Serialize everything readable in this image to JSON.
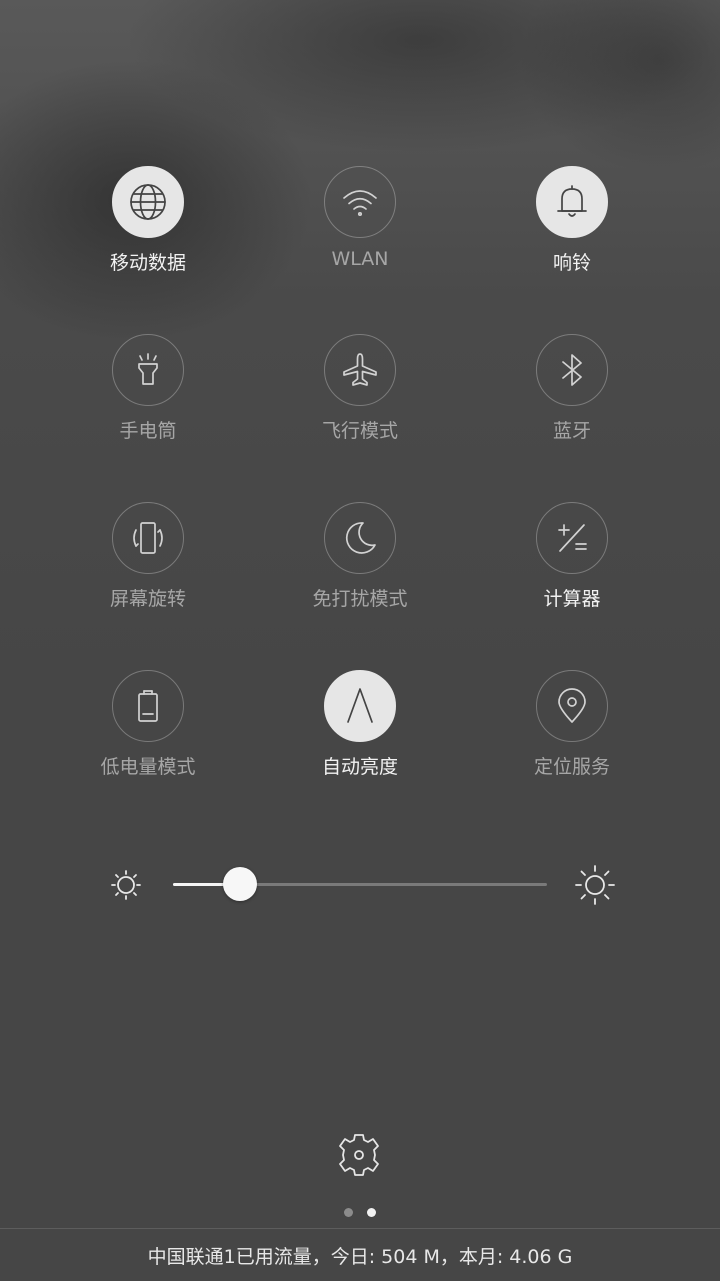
{
  "tiles": [
    {
      "label": "移动数据",
      "icon": "globe-icon",
      "state": "on"
    },
    {
      "label": "WLAN",
      "icon": "wifi-icon",
      "state": "off"
    },
    {
      "label": "响铃",
      "icon": "bell-icon",
      "state": "on"
    },
    {
      "label": "手电筒",
      "icon": "flashlight-icon",
      "state": "off"
    },
    {
      "label": "飞行模式",
      "icon": "airplane-icon",
      "state": "off"
    },
    {
      "label": "蓝牙",
      "icon": "bluetooth-icon",
      "state": "off"
    },
    {
      "label": "屏幕旋转",
      "icon": "rotate-screen-icon",
      "state": "off"
    },
    {
      "label": "免打扰模式",
      "icon": "moon-icon",
      "state": "off"
    },
    {
      "label": "计算器",
      "icon": "calculator-icon",
      "state": "off"
    },
    {
      "label": "低电量模式",
      "icon": "low-battery-icon",
      "state": "off"
    },
    {
      "label": "自动亮度",
      "icon": "auto-brightness-icon",
      "state": "on"
    },
    {
      "label": "定位服务",
      "icon": "location-pin-icon",
      "state": "off"
    }
  ],
  "brightness": {
    "level": 0.18,
    "min_icon": "sun-small-icon",
    "max_icon": "sun-large-icon"
  },
  "settings_icon": "gear-icon",
  "pager": {
    "count": 2,
    "active_index": 1
  },
  "footer": {
    "usage_text": "中国联通1已用流量，今日: 504 M，本月: 4.06 G"
  },
  "colors": {
    "active_tile": "#e6e6e6",
    "background": "#464646"
  }
}
